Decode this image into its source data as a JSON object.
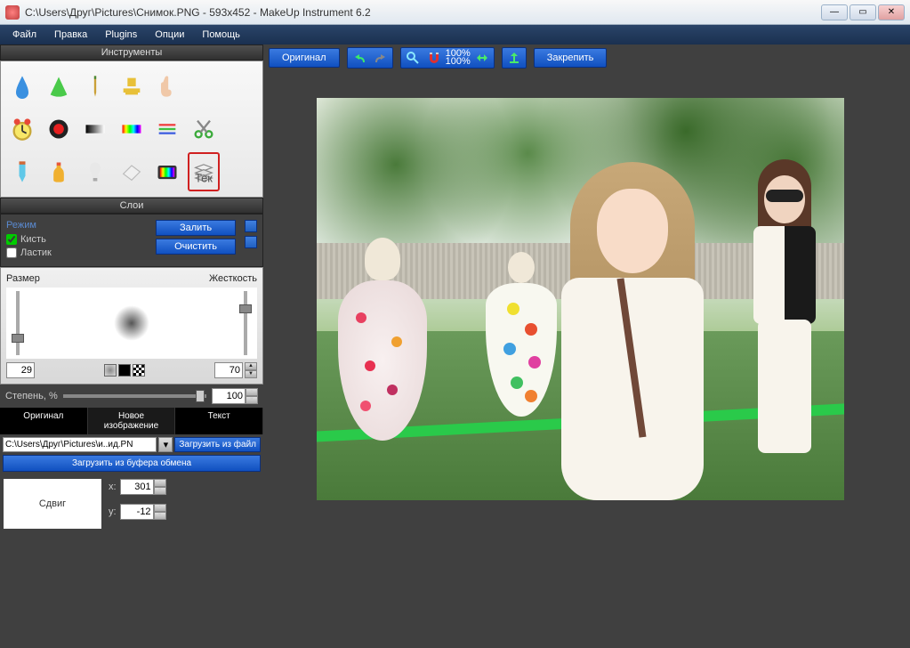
{
  "titlebar": {
    "text": "C:\\Users\\Друг\\Pictures\\Снимок.PNG - 593x452 - MakeUp Instrument 6.2"
  },
  "menu": {
    "file": "Файл",
    "edit": "Правка",
    "plugins": "Plugins",
    "options": "Опции",
    "help": "Помощь"
  },
  "panels": {
    "instruments": "Инструменты",
    "layers": "Слои"
  },
  "layers": {
    "mode": "Режим",
    "brush": "Кисть",
    "eraser": "Ластик",
    "fill": "Залить",
    "clear": "Очистить"
  },
  "sliders": {
    "size": "Размер",
    "hardness": "Жесткость",
    "size_val": "29",
    "hardness_val": "70",
    "degree": "Степень, %",
    "degree_val": "100"
  },
  "tabs": {
    "original": "Оригинал",
    "newimage": "Новое изображение",
    "text": "Текст"
  },
  "file": {
    "path": "C:\\Users\\Друг\\Pictures\\и..ид.PN",
    "load_file": "Загрузить из файл",
    "load_clipboard": "Загрузить из буфера обмена"
  },
  "offset": {
    "label": "Сдвиг",
    "x_label": "x:",
    "y_label": "y:",
    "x_val": "301",
    "y_val": "-12"
  },
  "toolbar": {
    "original": "Оригинал",
    "zoom100a": "100%",
    "zoom100b": "100%",
    "pin": "Закрепить"
  }
}
